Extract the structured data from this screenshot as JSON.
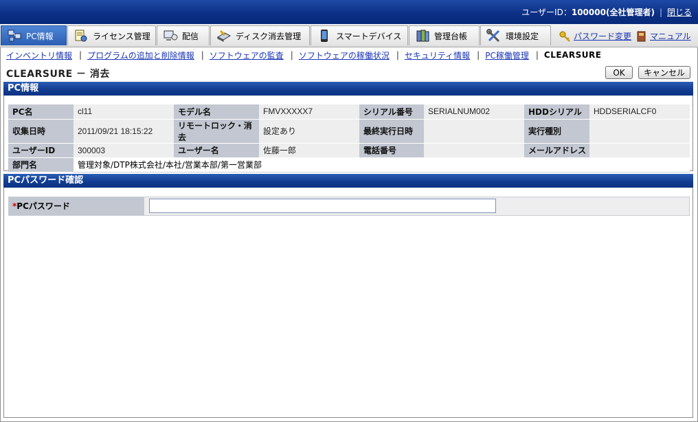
{
  "header": {
    "user_prefix": "ユーザーID：",
    "user_id": "100000",
    "user_role": "(全社管理者)",
    "close_link": "閉じる"
  },
  "nav": {
    "tabs": [
      {
        "label": "PC情報",
        "icon": "pc-network-icon",
        "active": true
      },
      {
        "label": "ライセンス管理",
        "icon": "license-icon",
        "active": false
      },
      {
        "label": "配信",
        "icon": "distribution-icon",
        "active": false
      },
      {
        "label": "ディスク消去管理",
        "icon": "disk-erase-icon",
        "active": false
      },
      {
        "label": "スマートデバイス",
        "icon": "smart-device-icon",
        "active": false
      },
      {
        "label": "管理台帳",
        "icon": "ledger-icon",
        "active": false
      },
      {
        "label": "環境設定",
        "icon": "tools-icon",
        "active": false
      }
    ],
    "password_change": "パスワード変更",
    "manual": "マニュアル"
  },
  "sublinks": {
    "items": [
      "インベントリ情報",
      "プログラムの追加と削除情報",
      "ソフトウェアの監査",
      "ソフトウェアの稼働状況",
      "セキュリティ情報",
      "PC稼働管理"
    ],
    "current": "CLEARSURE"
  },
  "page": {
    "title": "CLEARSURE － 消去",
    "ok_label": "OK",
    "cancel_label": "キャンセル"
  },
  "pc_info": {
    "heading": "PC情報",
    "rows": [
      [
        [
          "PC名",
          "cl11"
        ],
        [
          "モデル名",
          "FMVXXXXX7"
        ],
        [
          "シリアル番号",
          "SERIALNUM002"
        ],
        [
          "HDDシリアル",
          "HDDSERIALCF0"
        ]
      ],
      [
        [
          "収集日時",
          "2011/09/21 18:15:22"
        ],
        [
          "リモートロック・消去",
          "設定あり"
        ],
        [
          "最終実行日時",
          ""
        ],
        [
          "実行種別",
          ""
        ]
      ],
      [
        [
          "ユーザーID",
          "300003"
        ],
        [
          "ユーザー名",
          "佐藤一郎"
        ],
        [
          "電話番号",
          ""
        ],
        [
          "メールアドレス",
          ""
        ]
      ]
    ],
    "dept_label": "部門名",
    "dept_value": "管理対象/DTP株式会社/本社/営業本部/第一営業部"
  },
  "pw_section": {
    "heading": "PCパスワード確認",
    "required_mark": "*",
    "label": "PCパスワード",
    "value": ""
  }
}
